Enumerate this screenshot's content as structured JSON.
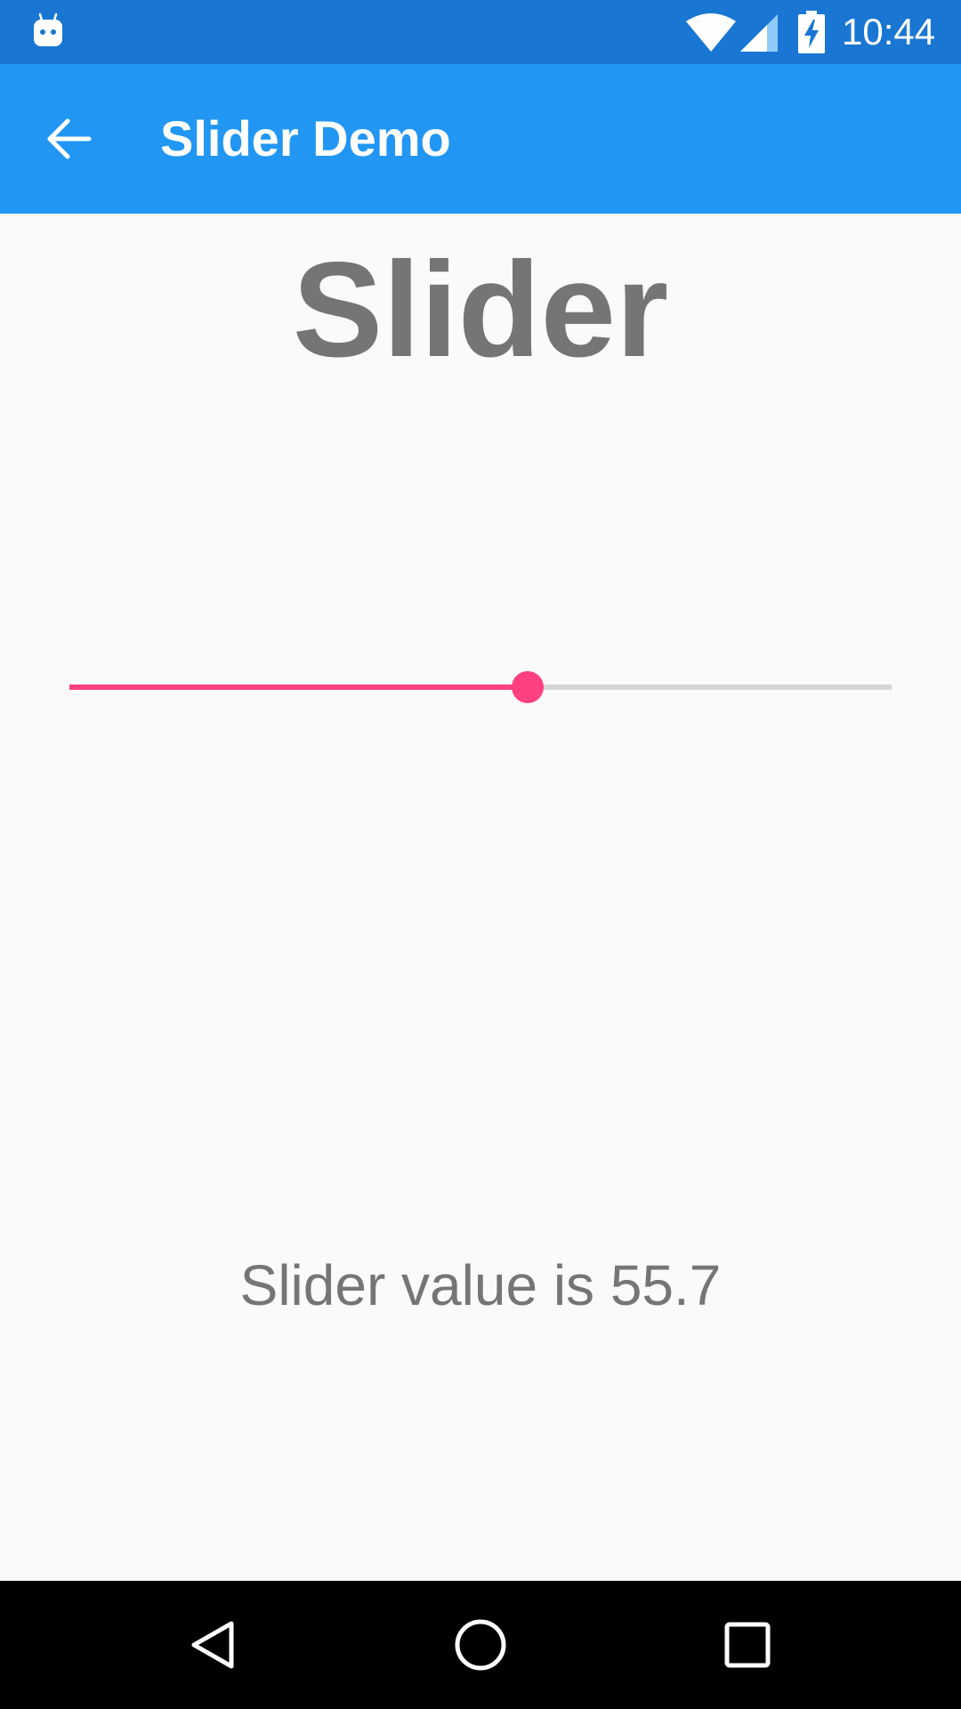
{
  "status_bar": {
    "time": "10:44",
    "icons": [
      "android-debug-icon",
      "wifi-icon",
      "cell-signal-icon",
      "battery-charging-icon"
    ],
    "background": "#1976d2"
  },
  "app_bar": {
    "title": "Slider Demo",
    "back_icon": "arrow-back-icon",
    "background": "#2196f3"
  },
  "main": {
    "heading": "Slider",
    "slider": {
      "value": 55.7,
      "min": 0,
      "max": 100,
      "accent_color": "#ff4081"
    },
    "value_text": "Slider value is 55.7"
  },
  "nav_bar": {
    "icons": [
      "back-triangle-icon",
      "home-circle-icon",
      "recents-square-icon"
    ]
  }
}
